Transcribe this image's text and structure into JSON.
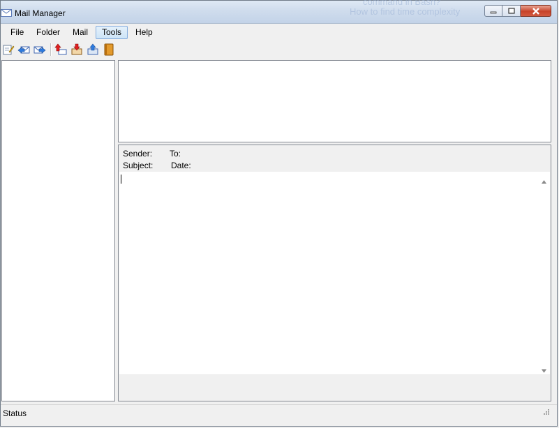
{
  "window": {
    "title": "Mail Manager",
    "background_ghost": [
      "command in Bash?",
      "How to find time complexity"
    ]
  },
  "menu": [
    "File",
    "Folder",
    "Mail",
    "Tools",
    "Help"
  ],
  "menu_active": "Tools",
  "toolbar": {
    "icons": [
      "new-mail-icon",
      "reply-icon",
      "forward-icon",
      "receive-icon",
      "inbox-icon",
      "send-icon",
      "address-book-icon"
    ]
  },
  "preview": {
    "sender_label": "Sender:",
    "to_label": "To:",
    "subject_label": "Subject:",
    "date_label": "Date:"
  },
  "status": {
    "text": "Status"
  },
  "colors": {
    "accent": "#84acdd",
    "close": "#c7432a",
    "pane_border": "#828790"
  }
}
